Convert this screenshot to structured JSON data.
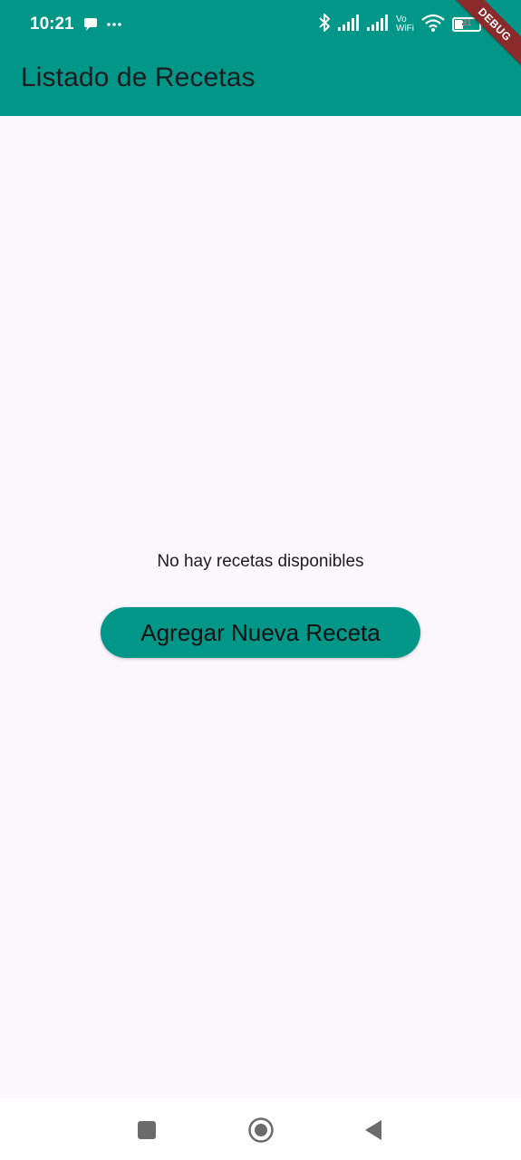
{
  "status_bar": {
    "time": "10:21",
    "icons": [
      "chat-bubble-icon",
      "more-dots-icon",
      "bluetooth-icon",
      "signal-icon",
      "signal-icon",
      "vowifi-icon",
      "wifi-icon",
      "battery-icon"
    ],
    "vowifi_top": "Vo",
    "vowifi_bottom": "WiFi",
    "battery_level": "31"
  },
  "debug_banner": {
    "label": "DEBUG",
    "color": "#8A2A2A"
  },
  "app_bar": {
    "title": "Listado de Recetas",
    "color": "#009688"
  },
  "main": {
    "empty_message": "No hay recetas disponibles",
    "add_button_label": "Agregar Nueva Receta",
    "background": "#FCF7FC"
  },
  "nav_bar": {
    "buttons": [
      "recents-square-icon",
      "home-circle-icon",
      "back-triangle-icon"
    ]
  }
}
